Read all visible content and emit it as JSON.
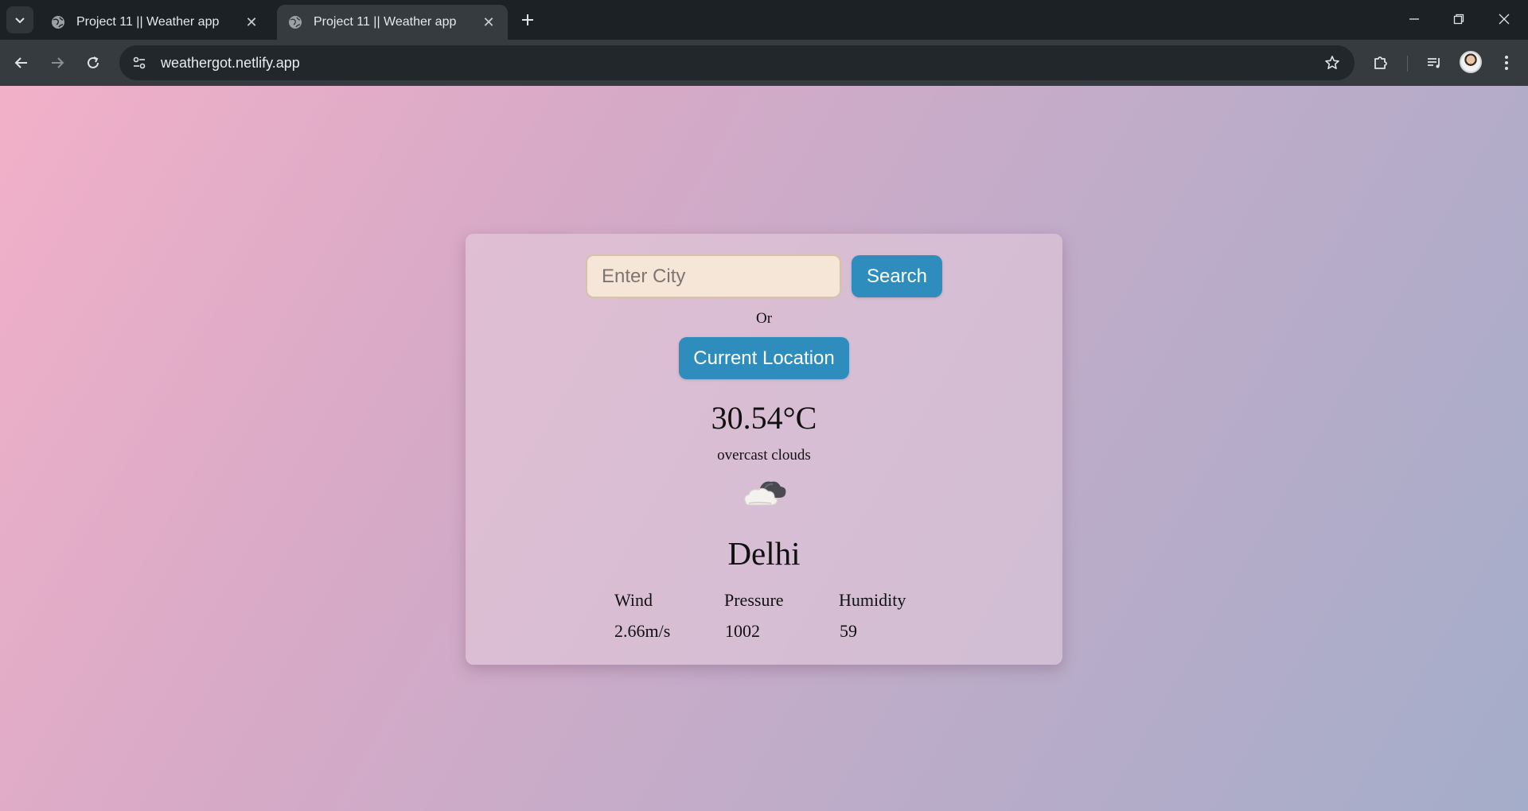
{
  "browser": {
    "tabs": [
      {
        "title": "Project 11 || Weather app",
        "active": false
      },
      {
        "title": "Project 11 || Weather app",
        "active": true
      }
    ],
    "url": "weathergot.netlify.app"
  },
  "app": {
    "search": {
      "placeholder": "Enter City",
      "button_label": "Search"
    },
    "or_label": "Or",
    "location_button_label": "Current Location",
    "temperature": "30.54°C",
    "description": "overcast clouds",
    "icon": "cloud-icon",
    "city": "Delhi",
    "stats": [
      {
        "label": "Wind",
        "value": "2.66m/s"
      },
      {
        "label": "Pressure",
        "value": "1002"
      },
      {
        "label": "Humidity",
        "value": "59"
      }
    ]
  },
  "colors": {
    "button": "#2f8dbe",
    "gradient_start": "#f2b0c8",
    "gradient_end": "#a4adc9"
  }
}
